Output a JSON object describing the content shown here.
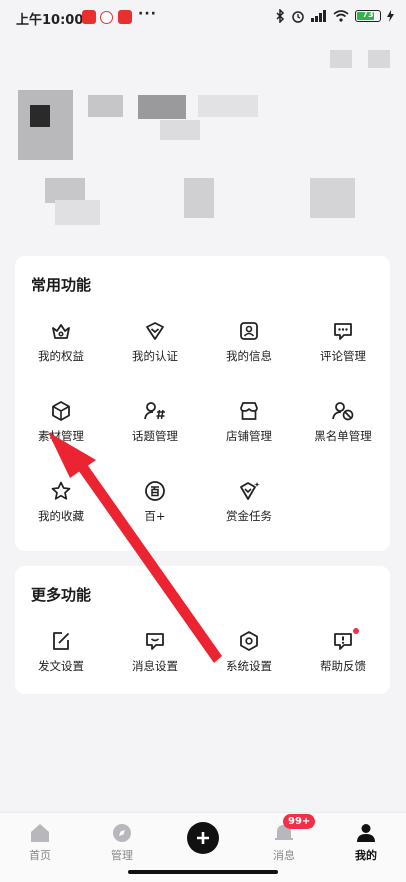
{
  "status_bar": {
    "time": "上午10:00",
    "dots": "···",
    "battery": "73"
  },
  "common_section": {
    "title": "常用功能",
    "items": [
      {
        "label": "我的权益",
        "icon": "crown-box-icon"
      },
      {
        "label": "我的认证",
        "icon": "shield-check-icon"
      },
      {
        "label": "我的信息",
        "icon": "id-card-icon"
      },
      {
        "label": "评论管理",
        "icon": "comment-icon"
      },
      {
        "label": "素材管理",
        "icon": "cube-icon"
      },
      {
        "label": "话题管理",
        "icon": "topic-icon"
      },
      {
        "label": "店铺管理",
        "icon": "shop-icon"
      },
      {
        "label": "黑名单管理",
        "icon": "blocked-user-icon"
      },
      {
        "label": "我的收藏",
        "icon": "star-icon"
      },
      {
        "label": "百+",
        "icon": "bai-icon"
      },
      {
        "label": "赏金任务",
        "icon": "bounty-icon"
      }
    ]
  },
  "more_section": {
    "title": "更多功能",
    "items": [
      {
        "label": "发文设置",
        "icon": "edit-icon"
      },
      {
        "label": "消息设置",
        "icon": "message-icon"
      },
      {
        "label": "系统设置",
        "icon": "settings-icon"
      },
      {
        "label": "帮助反馈",
        "icon": "feedback-icon"
      }
    ]
  },
  "tabbar": {
    "home": "首页",
    "manage": "管理",
    "messages": "消息",
    "messages_badge": "99+",
    "mine": "我的"
  },
  "colors": {
    "accent_red": "#f03048",
    "arrow_red": "#ec2330"
  }
}
